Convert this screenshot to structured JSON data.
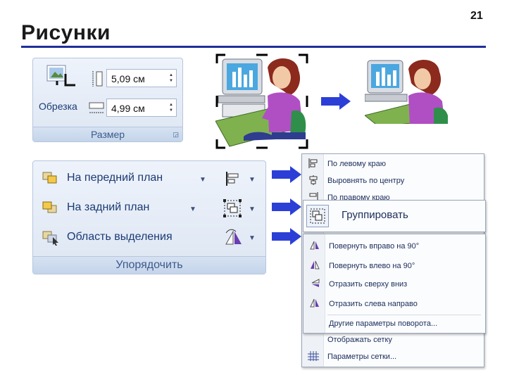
{
  "slide": {
    "title": "Рисунки",
    "page_number": "21"
  },
  "size_group": {
    "crop_label": "Обрезка",
    "height_value": "5,09 см",
    "width_value": "4,99 см",
    "footer": "Размер",
    "launcher_icon": "dialog-launcher-icon"
  },
  "arrange_group": {
    "bring_forward": "На передний план",
    "send_backward": "На задний план",
    "selection_pane": "Область выделения",
    "footer": "Упорядочить"
  },
  "align_menu": {
    "items": [
      "По левому краю",
      "Выровнять по центру",
      "По правому краю"
    ]
  },
  "group_menu": {
    "item": "Группировать"
  },
  "rotate_menu": {
    "items": [
      "Повернуть вправо на 90°",
      "Повернуть влево на 90°",
      "Отразить сверху вниз",
      "Отразить слева направо"
    ],
    "more": "Другие параметры поворота..."
  },
  "grid_menu": {
    "items": [
      "Отображать сетку",
      "Параметры сетки..."
    ]
  },
  "colors": {
    "accent": "#1f2f9a",
    "arrow": "#2b3fd6",
    "ribbon_text": "#1b3a73"
  }
}
